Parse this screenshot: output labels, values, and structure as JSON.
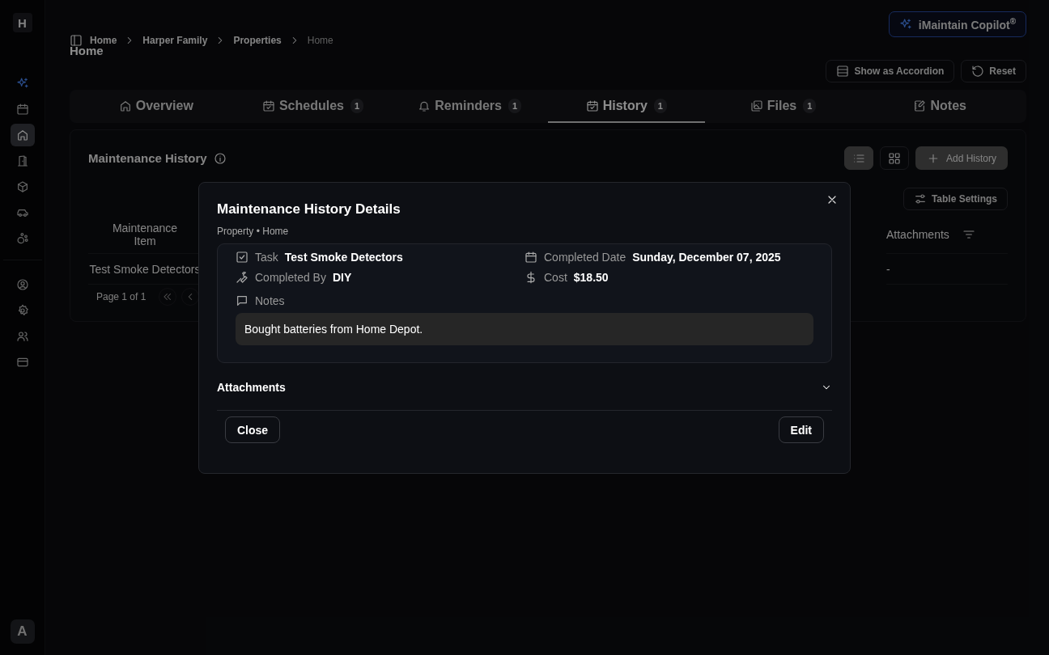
{
  "sidebar": {
    "logo": "H",
    "items": [
      {
        "selected": false
      },
      {
        "selected": false
      },
      {
        "selected": true
      },
      {
        "selected": false
      },
      {
        "selected": false
      },
      {
        "selected": false
      },
      {
        "selected": false
      }
    ],
    "account_items": [
      {
        "selected": false
      },
      {
        "selected": false
      },
      {
        "selected": false
      },
      {
        "selected": false
      }
    ],
    "avatar": "A"
  },
  "copilot_button": "iMaintain Copilot$^{®}$",
  "breadcrumb": [
    "Home",
    "Harper Family",
    "Properties",
    "Home"
  ],
  "page_title": "Home",
  "view_buttons": [
    "Show as Accordion",
    "Reset"
  ],
  "tabs": [
    {
      "label": "Overview",
      "selected": false
    },
    {
      "label": "Schedules",
      "count": "1",
      "selected": false
    },
    {
      "label": "Reminders",
      "count": "1",
      "selected": false
    },
    {
      "label": "History",
      "count": "1",
      "selected": true
    },
    {
      "label": "Files",
      "count": "1",
      "selected": false
    },
    {
      "label": "Notes",
      "selected": false
    }
  ],
  "section": {
    "title": "Maintenance History",
    "list_view": {
      "selected": true
    },
    "grid_view": {
      "selected": false
    },
    "add_button": "Add History",
    "table_settings": "Table Settings"
  },
  "table": {
    "columns": [
      "Maintenance Item",
      "Attachments"
    ],
    "rows": [
      [
        "Test Smoke Detectors",
        "-"
      ]
    ],
    "pagination": "Page 1 of 1"
  },
  "dialog": {
    "title": "Maintenance History Details",
    "subtitle": "Property • Home",
    "fields": [
      {
        "label": "Task",
        "value": "Test Smoke Detectors"
      },
      {
        "label": "Completed Date",
        "value": "Sunday, December 07, 2025"
      },
      {
        "label": "Completed By",
        "value": "DIY"
      },
      {
        "label": "Cost",
        "value": "$18.50"
      }
    ],
    "notes_label": "Notes",
    "notes": "Bought batteries from Home Depot.",
    "attachments": {
      "label": "Attachments",
      "expanded": false
    },
    "buttons": [
      "Close",
      "Edit"
    ]
  }
}
